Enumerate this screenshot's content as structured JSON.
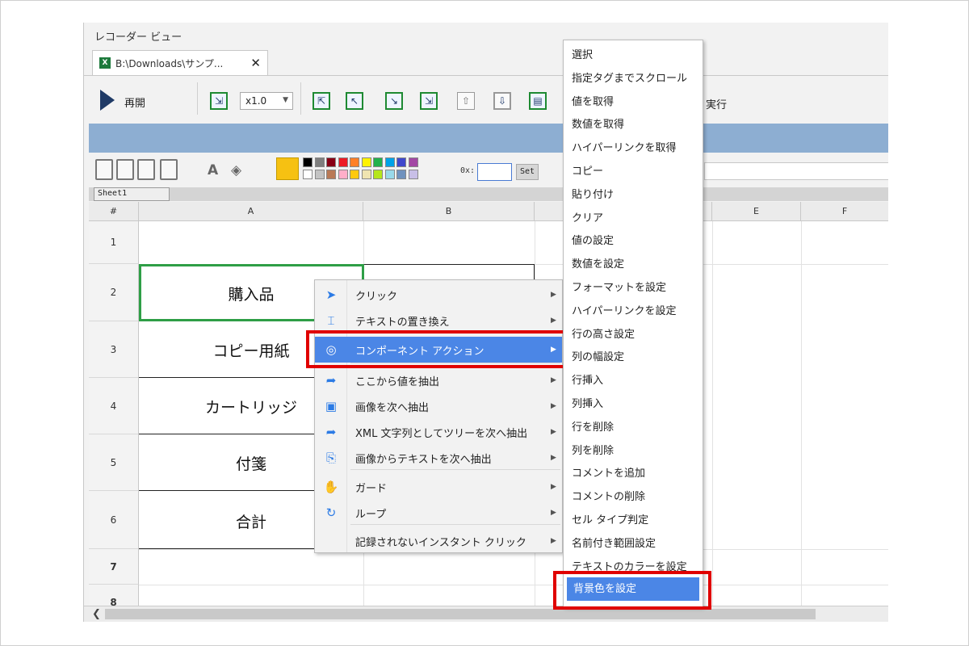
{
  "app": {
    "title": "レコーダー ビュー",
    "tab_label": "B:\\Downloads\\サンプ...",
    "tab_close": "✕",
    "tab_icon": "X"
  },
  "toolbar": {
    "play_label": "再開",
    "speed_value": "x1.0",
    "run_label": "実行"
  },
  "format_bar": {
    "hex_label": "0x:",
    "hex_value": "",
    "set_label": "Set",
    "selected_color": "#f6c112",
    "palette_row1": [
      "#000000",
      "#7f7f7f",
      "#880015",
      "#ed1c24",
      "#ff7f27",
      "#fff200",
      "#22b14c",
      "#00a2e8",
      "#3f48cc",
      "#a349a4"
    ],
    "palette_row2": [
      "#ffffff",
      "#c3c3c3",
      "#b97a57",
      "#ffaec9",
      "#ffc90e",
      "#efe4b0",
      "#b5e61d",
      "#99d9ea",
      "#7092be",
      "#c8bfe7"
    ]
  },
  "sheet": {
    "tab_label": "Sheet1",
    "corner": "#",
    "columns": [
      "A",
      "B",
      "",
      "",
      "E",
      "F"
    ],
    "rows": [
      "1",
      "2",
      "3",
      "4",
      "5",
      "6",
      "7",
      "8"
    ],
    "cells": [
      "",
      "購入品",
      "コピー用紙",
      "カートリッジ",
      "付箋",
      "合計"
    ]
  },
  "context_menu": {
    "items": [
      {
        "label": "クリック",
        "icon": "cursor-arrow-icon",
        "glyph": "➤",
        "arrow": "▶"
      },
      {
        "label": "テキストの置き換え",
        "icon": "text-replace-icon",
        "glyph": "⌶",
        "arrow": "▶"
      },
      {
        "label": "コンポーネント アクション",
        "icon": "component-icon",
        "glyph": "◎",
        "arrow": "▶"
      },
      {
        "label": "ここから値を抽出",
        "icon": "extract-arrow-icon",
        "glyph": "➦",
        "arrow": "▶"
      },
      {
        "label": "画像を次へ抽出",
        "icon": "image-icon",
        "glyph": "▣",
        "arrow": "▶"
      },
      {
        "label": "XML 文字列としてツリーを次へ抽出",
        "icon": "extract-arrow-icon",
        "glyph": "➦",
        "arrow": "▶"
      },
      {
        "label": "画像からテキストを次へ抽出",
        "icon": "image-text-icon",
        "glyph": "⎘",
        "arrow": "▶"
      },
      {
        "label": "ガード",
        "icon": "hand-icon",
        "glyph": "✋",
        "arrow": "▶"
      },
      {
        "label": "ループ",
        "icon": "loop-icon",
        "glyph": "↻",
        "arrow": "▶"
      },
      {
        "label": "記録されないインスタント クリック",
        "icon": "",
        "glyph": "",
        "arrow": "▶"
      }
    ]
  },
  "submenu": {
    "items": [
      "選択",
      "指定タグまでスクロール",
      "値を取得",
      "数値を取得",
      "ハイパーリンクを取得",
      "コピー",
      "貼り付け",
      "クリア",
      "値の設定",
      "数値を設定",
      "フォーマットを設定",
      "ハイパーリンクを設定",
      "行の高さ設定",
      "列の幅設定",
      "行挿入",
      "列挿入",
      "行を削除",
      "列を削除",
      "コメントを追加",
      "コメントの削除",
      "セル タイプ判定",
      "名前付き範囲設定",
      "テキストのカラーを設定",
      "背景色を設定"
    ]
  },
  "colors": {
    "highlight": "#4b86e6",
    "annotation_red": "#e00000",
    "selection_green": "#2e9e46"
  }
}
